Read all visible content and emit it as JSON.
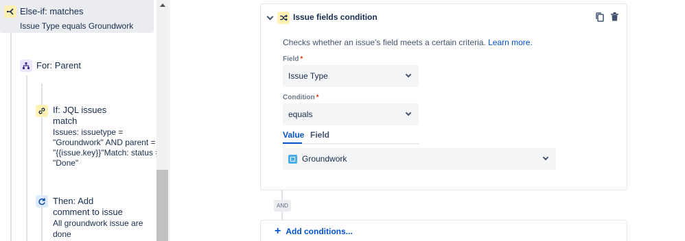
{
  "left": {
    "elseif": {
      "title": "Else-if: matches",
      "subtitle": "Issue Type equals Groundwork"
    },
    "for_parent": {
      "title": "For: Parent"
    },
    "if_jql": {
      "title_line1": "If: JQL issues",
      "title_line2": "match",
      "sub_lines": [
        "Issues: issuetype =",
        "\"Groundwork\" AND parent =",
        "\"{{issue.key}}\"Match: status =",
        "\"Done\""
      ]
    },
    "then_add": {
      "title_line1": "Then: Add",
      "title_line2": "comment to issue",
      "sub_lines": [
        "All groundwork issue are",
        "done"
      ]
    }
  },
  "condition": {
    "title": "Issue fields condition",
    "description": "Checks whether an issue's field meets a certain criteria.",
    "learn_more": "Learn more.",
    "field_label": "Field",
    "field_value": "Issue Type",
    "condition_label": "Condition",
    "condition_value": "equals",
    "required_mark": "*",
    "tabs": [
      "Value",
      "Field"
    ],
    "value_selected": "Groundwork"
  },
  "and_label": "AND",
  "add_conditions": "Add conditions...",
  "colors": {
    "accent": "#0052cc",
    "required": "#de350b"
  }
}
